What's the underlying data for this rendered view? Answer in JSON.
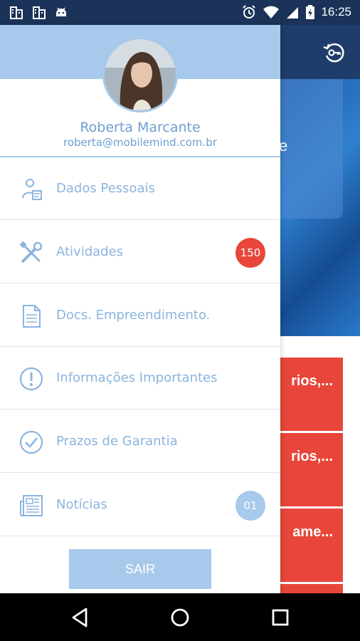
{
  "status_bar": {
    "time": "16:25",
    "icons": [
      "building-icon",
      "building-icon",
      "android-icon",
      "alarm-icon",
      "wifi-icon",
      "signal-icon",
      "battery-charging-icon"
    ]
  },
  "header": {
    "icon": "history-key-icon"
  },
  "hero": {
    "partial_text": "e"
  },
  "user": {
    "name": "Roberta Marcante",
    "email": "roberta@mobilemind.com.br"
  },
  "menu": {
    "items": [
      {
        "label": "Dados Pessoais",
        "icon": "user-id-icon"
      },
      {
        "label": "Atividades",
        "icon": "tools-icon",
        "badge": "150",
        "badge_color": "#e8463a"
      },
      {
        "label": "Docs. Empreendimento.",
        "icon": "document-icon"
      },
      {
        "label": "Informações Importantes",
        "icon": "alert-circle-icon"
      },
      {
        "label": "Prazos de Garantia",
        "icon": "check-circle-icon"
      },
      {
        "label": "Notícias",
        "icon": "newspaper-icon",
        "badge": "01",
        "badge_color": "#a7c9eb"
      }
    ],
    "logout_label": "SAIR"
  },
  "background_cards": [
    "rios,...",
    "rios,...",
    "ame..."
  ],
  "colors": {
    "status_bar": "#1b3358",
    "header_band": "#a7c9eb",
    "accent_text": "#8bb4de",
    "badge_red": "#e8463a",
    "card_red": "#e8463a"
  },
  "nav": {
    "icons": [
      "back-icon",
      "home-icon",
      "recents-icon"
    ]
  }
}
